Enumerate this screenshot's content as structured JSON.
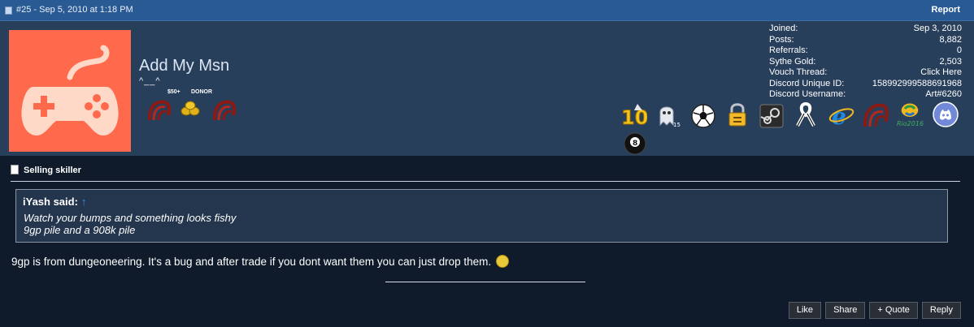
{
  "header": {
    "post_info": "#25 - Sep 5, 2010 at 1:18 PM",
    "report_label": "Report",
    "accent": "#2a5a94"
  },
  "user": {
    "username": "Add My Msn",
    "title": "^__^",
    "avatar_icon": "gamepad-icon",
    "avatar_color": "#ff6a4d",
    "badges": {
      "donor_amount": "$50+",
      "donor_label": "DONOR"
    },
    "stats": [
      {
        "label": "Joined:",
        "value": "Sep 3, 2010"
      },
      {
        "label": "Posts:",
        "value": "8,882"
      },
      {
        "label": "Referrals:",
        "value": "0"
      },
      {
        "label": "Sythe Gold:",
        "value": "2,503"
      },
      {
        "label": "Vouch Thread:",
        "value": "Click Here"
      },
      {
        "label": "Discord Unique ID:",
        "value": "158992999588691968"
      },
      {
        "label": "Discord Username:",
        "value": "Art#6260"
      }
    ],
    "awards": {
      "anniversary_number": "10",
      "ghost_count": "15",
      "rio_text": "Rio2016",
      "names": [
        "ten-year-icon",
        "ghost-icon",
        "soccer-ball-icon",
        "padlock-icon",
        "steam-icon",
        "ribbon-icon",
        "ie-icon",
        "claw-icon",
        "rio-2016-icon",
        "discord-icon",
        "eight-ball-icon"
      ]
    }
  },
  "post": {
    "thread_title": "Selling skiller",
    "quote": {
      "author": "iYash said:",
      "arrow": "↑",
      "lines": [
        "Watch your bumps and something looks fishy",
        "9gp pile and a 908k pile"
      ]
    },
    "message": "9gp is from dungeoneering. It's a bug and after trade if you dont want them you can just drop them."
  },
  "actions": {
    "like": "Like",
    "share": "Share",
    "quote": "+ Quote",
    "reply": "Reply"
  }
}
